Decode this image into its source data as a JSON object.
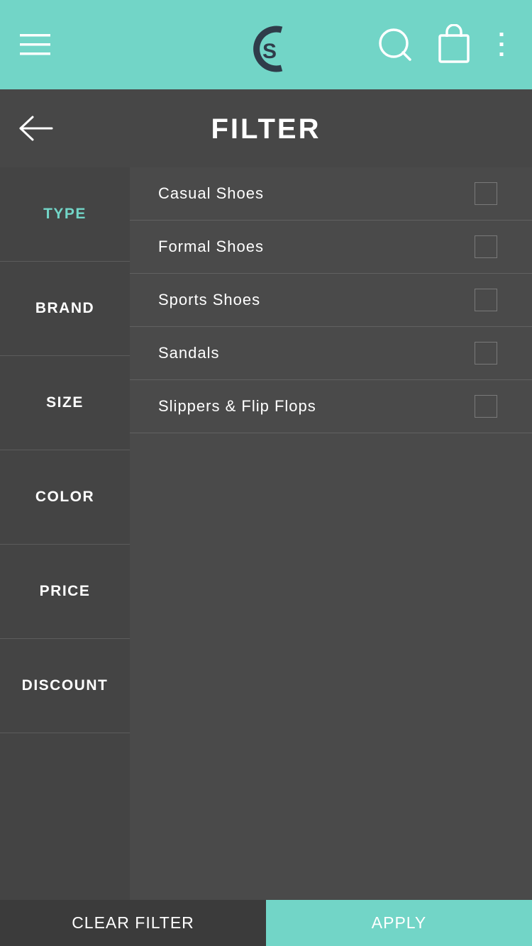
{
  "app_bar": {
    "menu_icon": "hamburger-menu-icon",
    "logo_text": "S",
    "search_icon": "search-icon",
    "cart_icon": "shopping-bag-icon",
    "more_icon": "more-vertical-icon",
    "background_color": "#72d5c7",
    "logo_color": "#2f3c4a"
  },
  "filter_header": {
    "back_icon": "back-arrow-icon",
    "title": "FILTER"
  },
  "categories": [
    {
      "label": "TYPE",
      "active": true
    },
    {
      "label": "BRAND",
      "active": false
    },
    {
      "label": "SIZE",
      "active": false
    },
    {
      "label": "COLOR",
      "active": false
    },
    {
      "label": "PRICE",
      "active": false
    },
    {
      "label": "DISCOUNT",
      "active": false
    }
  ],
  "options": [
    {
      "label": "Casual Shoes",
      "checked": false
    },
    {
      "label": "Formal Shoes",
      "checked": false
    },
    {
      "label": "Sports Shoes",
      "checked": false
    },
    {
      "label": "Sandals",
      "checked": false
    },
    {
      "label": "Slippers & Flip Flops",
      "checked": false
    }
  ],
  "bottom_bar": {
    "clear_label": "CLEAR FILTER",
    "apply_label": "APPLY"
  },
  "colors": {
    "accent": "#72d5c7",
    "panel_dark": "#444444",
    "panel": "#4a4a4a"
  }
}
